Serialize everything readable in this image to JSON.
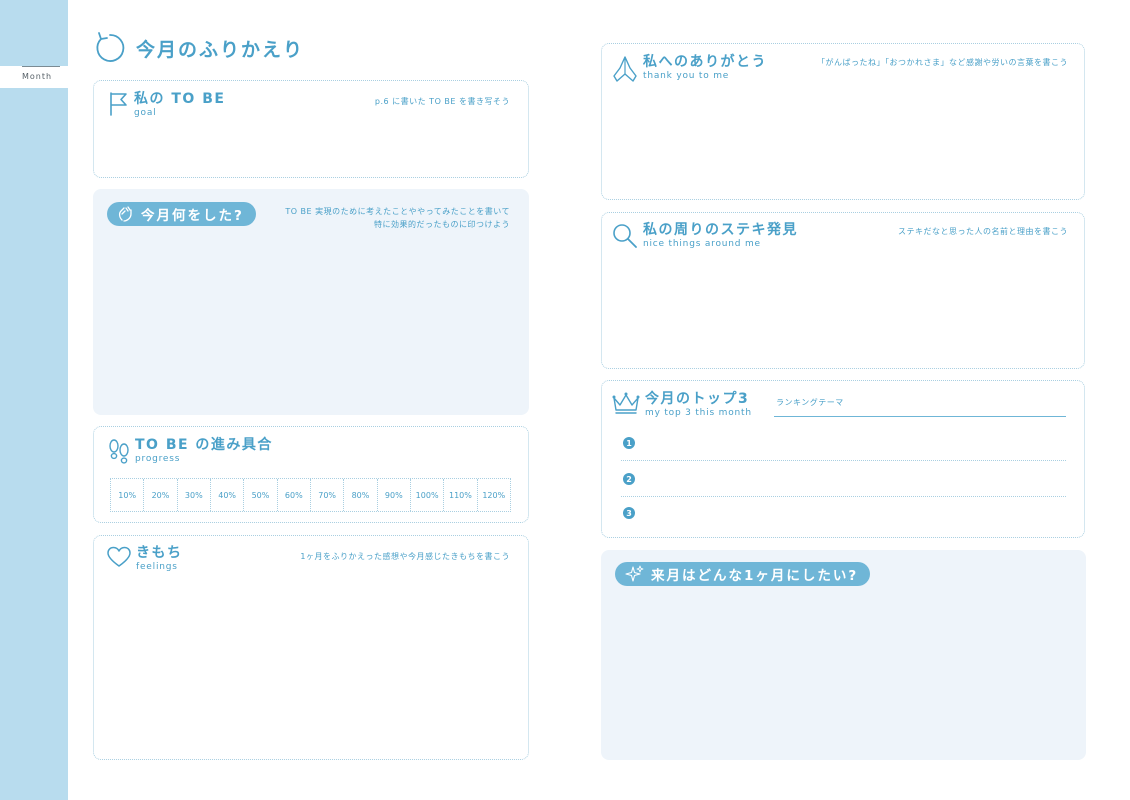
{
  "sidebar": {
    "month_label": "Month"
  },
  "page_title": "今月のふりかえり",
  "to_be": {
    "title": "私の TO BE",
    "subtitle": "goal",
    "hint": "p.6 に書いた TO BE を書き写そう"
  },
  "did": {
    "title": "今月何をした?",
    "hint_line1": "TO BE 実現のために考えたことややってみたことを書いて",
    "hint_line2": "特に効果的だったものに印つけよう"
  },
  "progress": {
    "title": "TO BE の進み具合",
    "subtitle": "progress",
    "cells": [
      "10%",
      "20%",
      "30%",
      "40%",
      "50%",
      "60%",
      "70%",
      "80%",
      "90%",
      "100%",
      "110%",
      "120%"
    ]
  },
  "feelings": {
    "title": "きもち",
    "subtitle": "feelings",
    "hint": "1ヶ月をふりかえった感想や今月感じたきもちを書こう"
  },
  "thanks": {
    "title": "私へのありがとう",
    "subtitle": "thank you to me",
    "hint": "「がんばったね」「おつかれさま」など感謝や労いの言葉を書こう"
  },
  "nice": {
    "title": "私の周りのステキ発見",
    "subtitle": "nice things around me",
    "hint": "ステキだなと思った人の名前と理由を書こう"
  },
  "top3": {
    "title": "今月のトップ3",
    "subtitle": "my top 3 this month",
    "theme_label": "ランキングテーマ",
    "ranks": [
      "1",
      "2",
      "3"
    ]
  },
  "next_month": {
    "title": "来月はどんな1ヶ月にしたい?"
  },
  "colors": {
    "accent": "#4aa0c8",
    "sidebar": "#b8dcee",
    "shade": "#eef4fa",
    "pill": "#6fb6d7"
  }
}
